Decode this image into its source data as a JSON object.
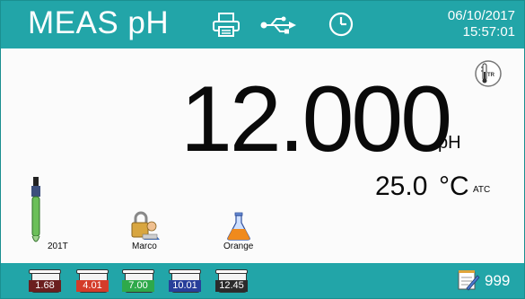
{
  "header": {
    "mode": "MEAS pH",
    "date": "06/10/2017",
    "time": "15:57:01",
    "icons": [
      "printer-icon",
      "usb-icon",
      "clock-icon"
    ]
  },
  "reading": {
    "value": "12.000",
    "unit": "pH",
    "temperature": "25.0",
    "temperature_unit": "°C",
    "compensation": "ATC",
    "sensor_badge": "TR"
  },
  "status": {
    "sensor": "201T",
    "user": "Marco",
    "sample": "Orange"
  },
  "buffers": [
    {
      "value": "1.68",
      "color": "#6b1f1f"
    },
    {
      "value": "4.01",
      "color": "#d43c2a"
    },
    {
      "value": "7.00",
      "color": "#2ea94a"
    },
    {
      "value": "10.01",
      "color": "#283f9a"
    },
    {
      "value": "12.45",
      "color": "#2b2b2b"
    }
  ],
  "memory": {
    "count": "999"
  },
  "colors": {
    "accent": "#22a5a8",
    "background": "#fbfbfb",
    "text": "#0a0a0a"
  }
}
